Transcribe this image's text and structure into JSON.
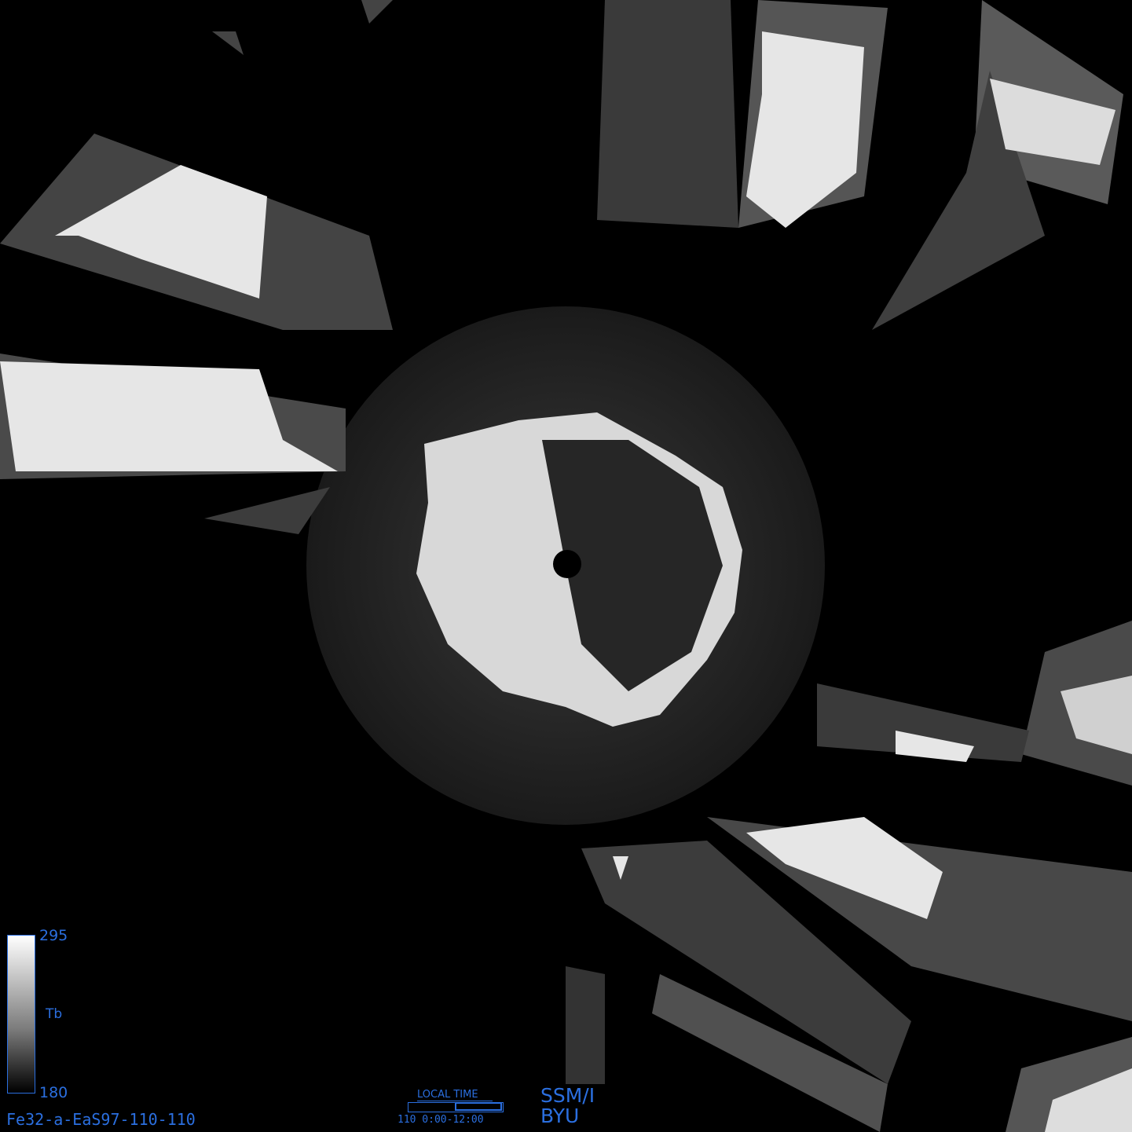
{
  "colorbar": {
    "max_label": "295",
    "min_label": "180",
    "unit_label": "Tb"
  },
  "filename": "Fe32-a-EaS97-110-110",
  "local_time": {
    "label": "LOCAL TIME",
    "range": "110 0:00-12:00",
    "fraction_filled": 0.5
  },
  "sensor": {
    "line1": "SSM/I",
    "line2": "BYU"
  },
  "colors": {
    "annotation": "#2b6fe0",
    "background": "#000000"
  }
}
